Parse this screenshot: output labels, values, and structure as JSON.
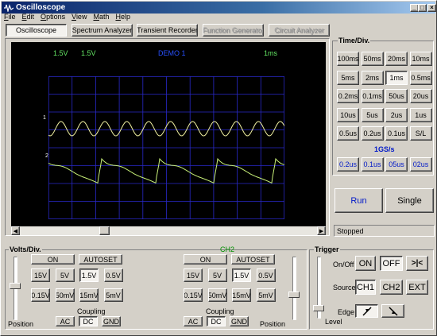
{
  "window": {
    "title": "Oscilloscope",
    "icon": "oscilloscope-app-icon"
  },
  "menu": [
    "File",
    "Edit",
    "Options",
    "View",
    "Math",
    "Help"
  ],
  "tabs": [
    {
      "label": "Oscilloscope",
      "state": "active"
    },
    {
      "label": "Spectrum Analyzer",
      "state": "enabled"
    },
    {
      "label": "Transient Recorder",
      "state": "enabled"
    },
    {
      "label": "Function Generator",
      "state": "disabled"
    },
    {
      "label": "Circuit Analyzer",
      "state": "disabled"
    }
  ],
  "scope": {
    "ch1_volts": "1.5V",
    "ch2_volts": "1.5V",
    "mode": "DEMO 1",
    "timebase": "1ms",
    "trace1_label": "1",
    "trace2_label": "2",
    "colors": {
      "background": "#000000",
      "grid": "#2828c8",
      "ch1": "#f0f0a0",
      "ch2": "#c8f078",
      "header_green": "#64e664",
      "header_blue": "#2850ff"
    }
  },
  "timediv": {
    "title": "Time/Div.",
    "buttons": [
      "100ms",
      "50ms",
      "20ms",
      "10ms",
      "5ms",
      "2ms",
      "1ms",
      "0.5ms",
      "0.2ms",
      "0.1ms",
      "50us",
      "20us",
      "10us",
      "5us",
      "2us",
      "1us",
      "0.5us",
      "0.2us",
      "0.1us",
      "S/L"
    ],
    "selected": "1ms",
    "fast_title": "1GS/s",
    "fast_buttons": [
      "0.2us",
      "0.1us",
      "05us",
      "02us"
    ]
  },
  "run": {
    "run_label": "Run",
    "single_label": "Single"
  },
  "status": "Stopped",
  "ch1": {
    "group_title": "Volts/Div.",
    "on_label": "ON",
    "autoset_label": "AUTOSET",
    "volts": [
      "15V",
      "5V",
      "1.5V",
      "0.5V",
      "0.15V",
      "50mV",
      "15mV",
      "5mV"
    ],
    "selected": "1.5V",
    "coupling_label": "Coupling",
    "coupling": [
      "AC",
      "DC",
      "GND"
    ],
    "coupling_selected": "DC",
    "position_label": "Position"
  },
  "ch2": {
    "title": "CH2",
    "on_label": "ON",
    "autoset_label": "AUTOSET",
    "volts": [
      "15V",
      "5V",
      "1.5V",
      "0.5V",
      "0.15V",
      "50mV",
      "15mV",
      "5mV"
    ],
    "selected": "1.5V",
    "coupling_label": "Coupling",
    "coupling": [
      "AC",
      "DC",
      "GND"
    ],
    "coupling_selected": "DC",
    "position_label": "Position"
  },
  "trigger": {
    "title": "Trigger",
    "onoff_label": "On/Off",
    "on_label": "ON",
    "off_label": "OFF",
    "onoff_selected": "OFF",
    "source_label": "Source",
    "sources": [
      "CH1",
      "CH2",
      "EXT"
    ],
    "source_selected": "CH1",
    "edge_label": "Edge",
    "level_label": "Level"
  }
}
